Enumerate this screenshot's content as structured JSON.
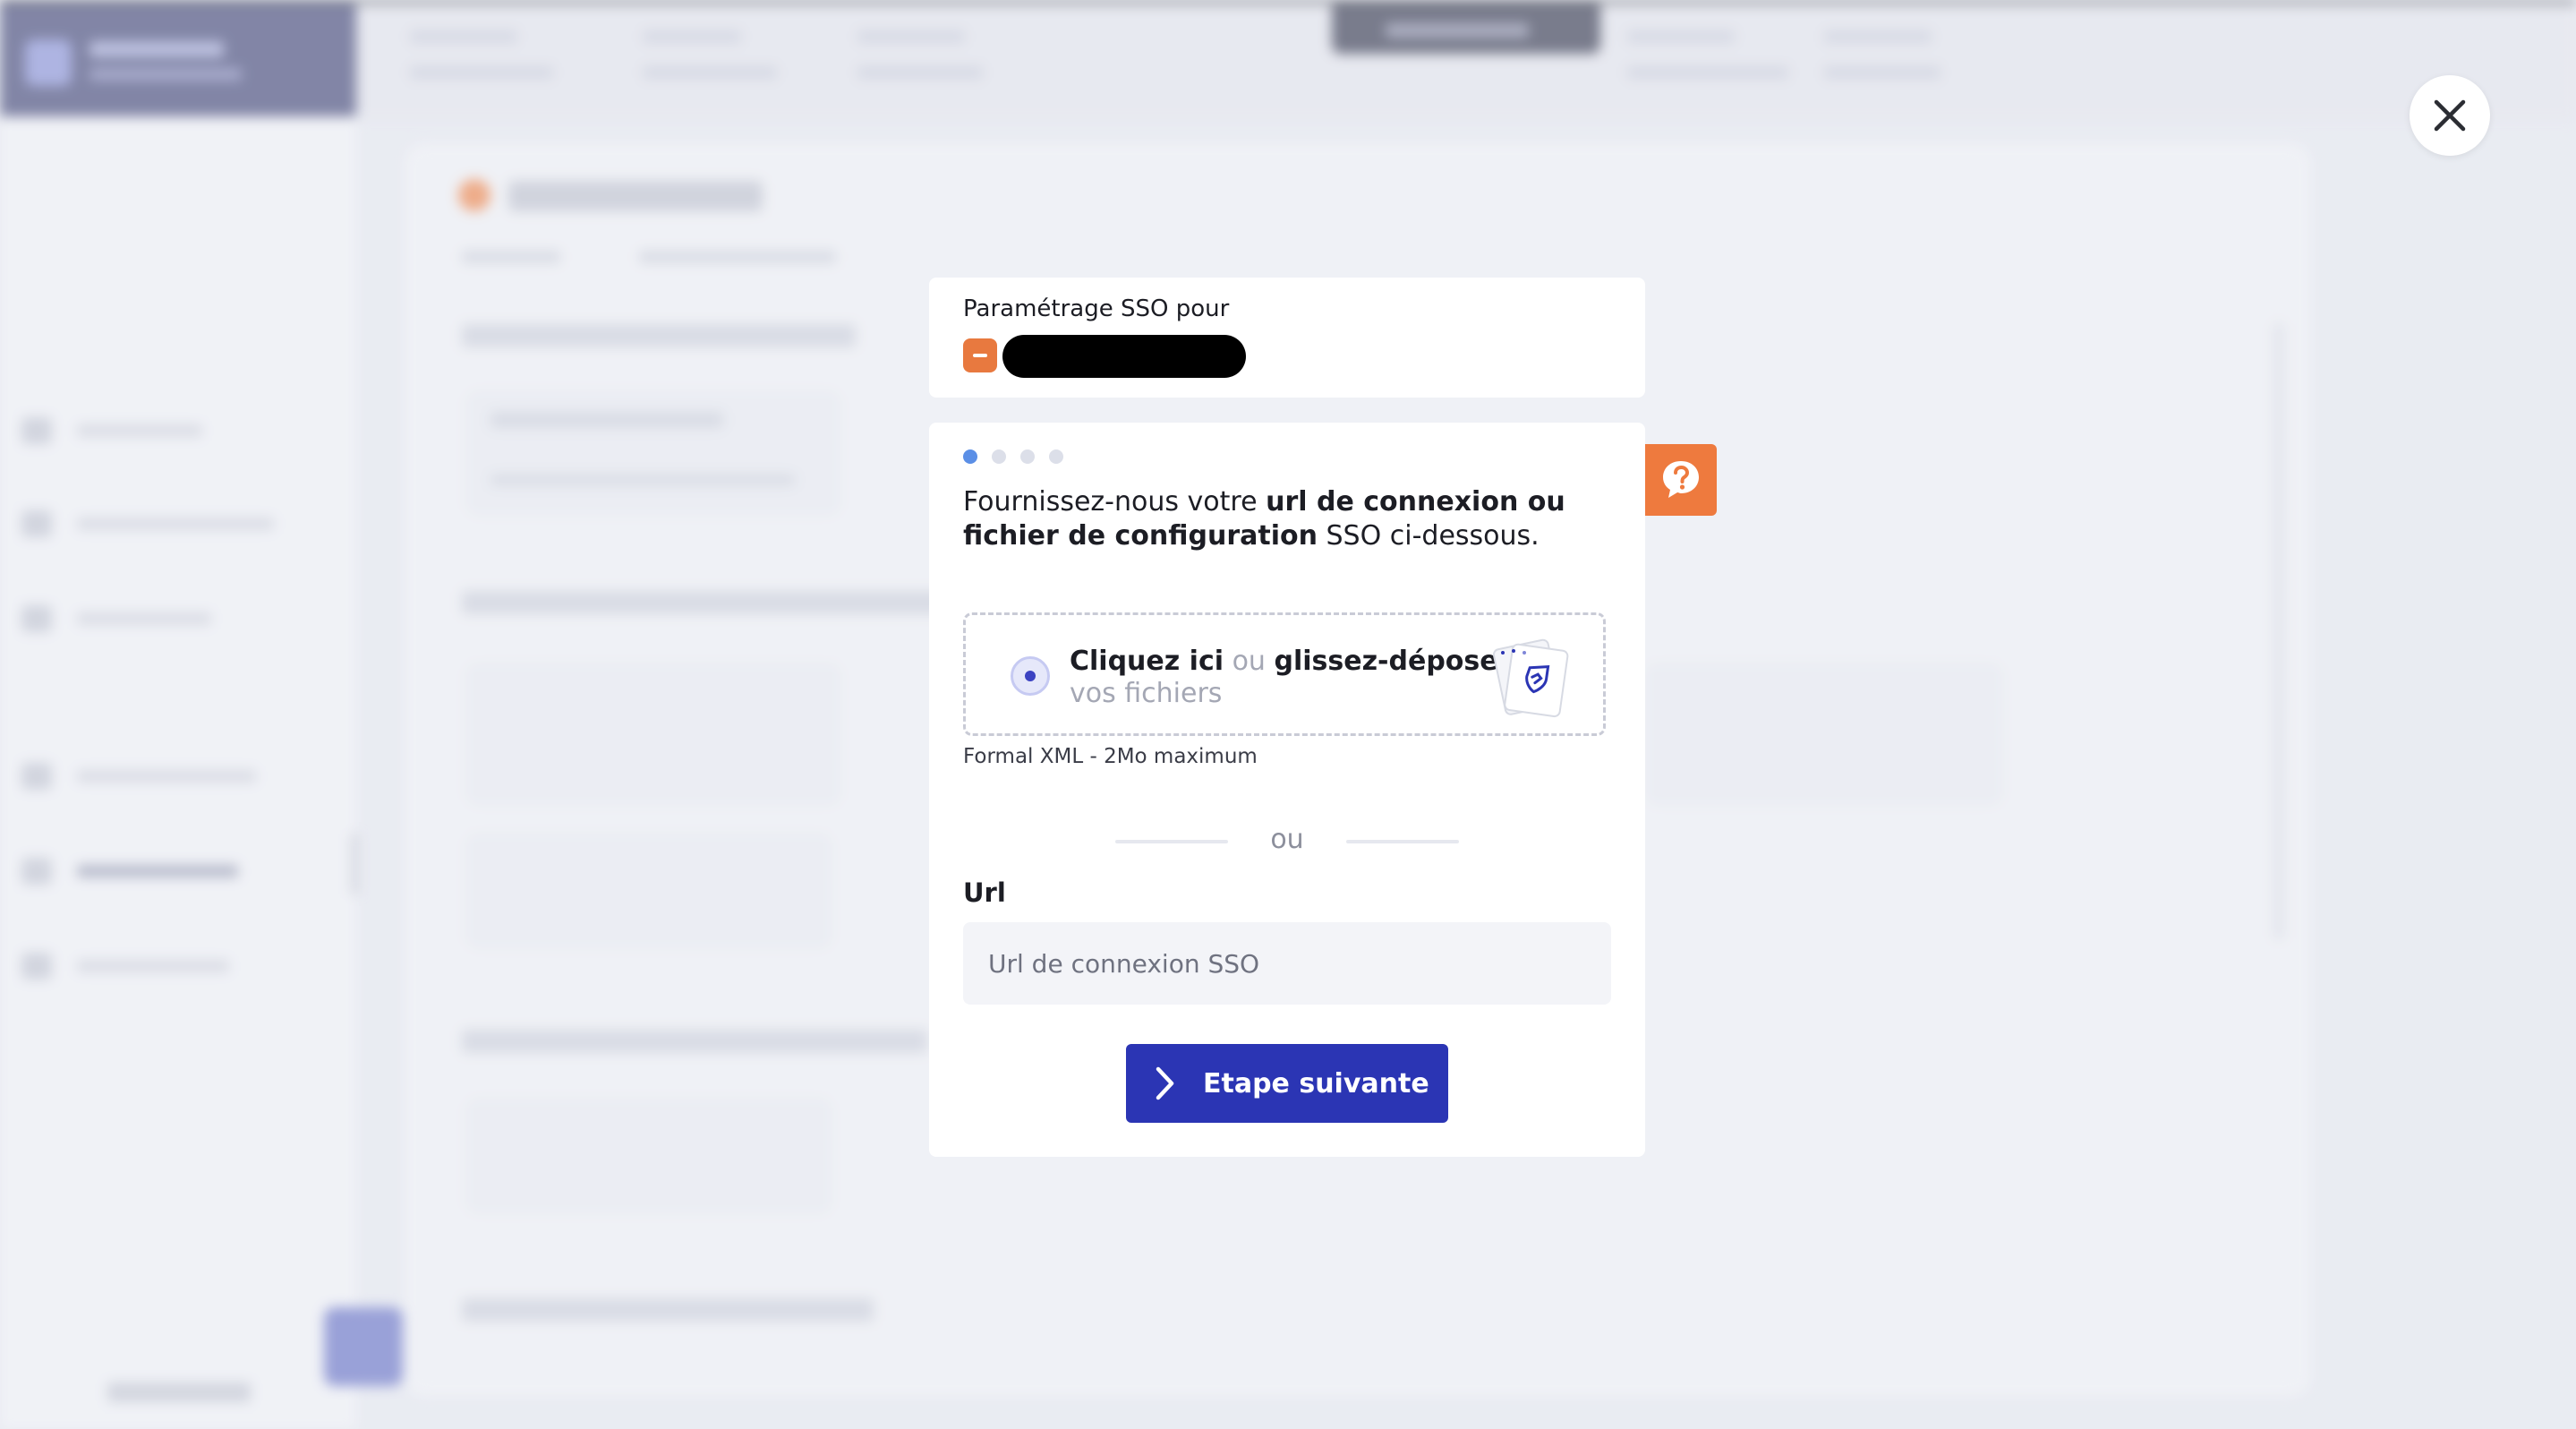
{
  "modal": {
    "header": {
      "title": "Paramétrage SSO pour"
    },
    "steps": {
      "total": 4,
      "current": 1
    },
    "intro": {
      "part1": "Fournissez-nous votre ",
      "bold1": "url de connexion ou fichier de configuration",
      "part2": " SSO ci-dessous."
    },
    "upload": {
      "click_label": "Cliquez ici",
      "or_label": "ou",
      "drop_label": "glissez-déposez",
      "files_label": "vos fichiers",
      "format_hint": "Formal XML - 2Mo maximum"
    },
    "separator": "ou",
    "url": {
      "label": "Url",
      "placeholder": "Url de connexion SSO",
      "value": ""
    },
    "next_button": "Etape suivante"
  },
  "icons": {
    "close": "close-icon",
    "help": "question-bubble-icon",
    "next": "chevron-right-icon",
    "files": "files-illustration-icon",
    "org": "organization-icon"
  },
  "colors": {
    "primary": "#2b35b4",
    "accent_orange": "#ee7a3e",
    "step_active": "#5b8fe6",
    "step_inactive": "#dcdfe9",
    "muted_text": "#a4a7b4"
  }
}
